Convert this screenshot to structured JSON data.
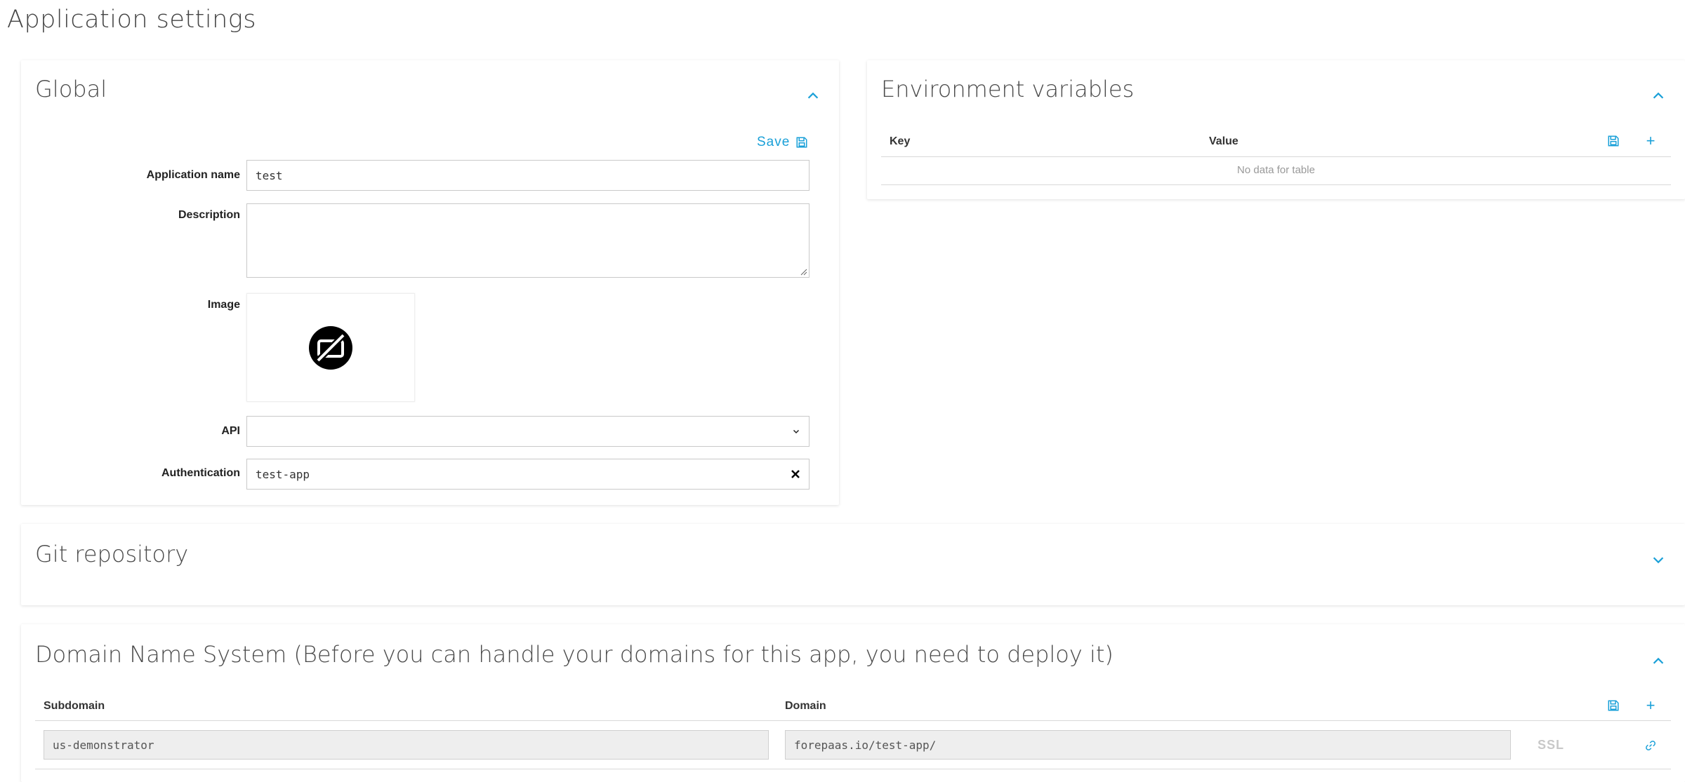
{
  "page": {
    "title": "Application settings"
  },
  "global": {
    "title": "Global",
    "save_label": "Save",
    "fields": {
      "app_name_label": "Application name",
      "app_name_value": "test",
      "description_label": "Description",
      "description_value": "",
      "image_label": "Image",
      "api_label": "API",
      "api_value": "",
      "auth_label": "Authentication",
      "auth_value": "test-app"
    }
  },
  "env": {
    "title": "Environment variables",
    "columns": [
      "Key",
      "Value"
    ],
    "empty_text": "No data for table"
  },
  "git": {
    "title": "Git repository"
  },
  "dns": {
    "title": "Domain Name System (Before you can handle your domains for this app, you need to deploy it)",
    "columns": [
      "Subdomain",
      "Domain"
    ],
    "rows": [
      {
        "subdomain": "us-demonstrator",
        "domain": "forepaas.io/test-app/",
        "ssl": "SSL"
      }
    ]
  },
  "colors": {
    "accent": "#1aa0d8"
  },
  "icons": [
    "chevron-up-icon",
    "chevron-down-icon",
    "save-icon",
    "plus-icon",
    "no-image-icon",
    "close-icon",
    "link-icon"
  ]
}
